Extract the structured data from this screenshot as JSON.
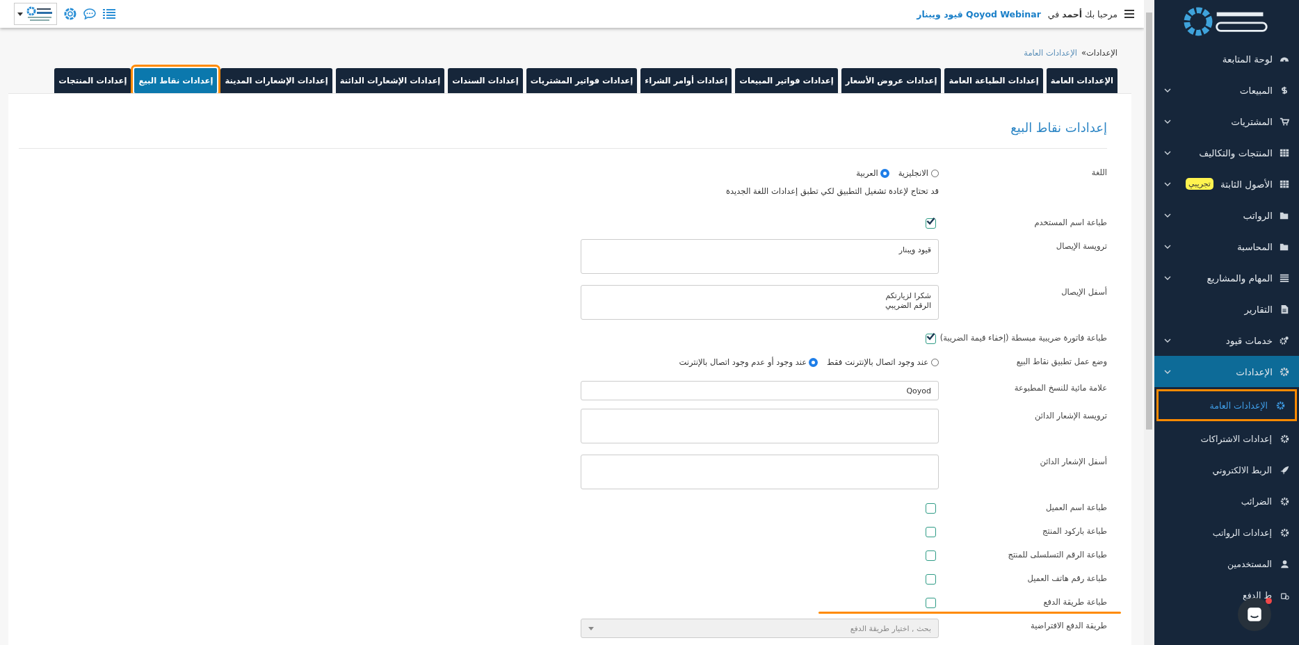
{
  "topbar": {
    "greeting": "مرحبا بك **أحمد** في",
    "company": "Qoyod Webinar قيود ويبنار"
  },
  "breadcrumb": {
    "parent": "الإعدادات»",
    "current": "الإعدادات العامة"
  },
  "tabs": [
    {
      "label": "الإعدادات العامة",
      "selected": false,
      "highlighted": false
    },
    {
      "label": "إعدادات الطباعة العامة",
      "selected": false,
      "highlighted": false
    },
    {
      "label": "إعدادات عروض الأسعار",
      "selected": false,
      "highlighted": false
    },
    {
      "label": "إعدادات فواتير المبيعات",
      "selected": false,
      "highlighted": false
    },
    {
      "label": "إعدادات أوامر الشراء",
      "selected": false,
      "highlighted": false
    },
    {
      "label": "إعدادات فواتير المشتريات",
      "selected": false,
      "highlighted": false
    },
    {
      "label": "إعدادات السندات",
      "selected": false,
      "highlighted": false
    },
    {
      "label": "إعدادات الإشعارات الدائنة",
      "selected": false,
      "highlighted": false
    },
    {
      "label": "إعدادات الإشعارات المدينة",
      "selected": false,
      "highlighted": false
    },
    {
      "label": "إعدادات نقاط البيع",
      "selected": true,
      "highlighted": true
    },
    {
      "label": "إعدادات المنتجات",
      "selected": false,
      "highlighted": false
    }
  ],
  "panel": {
    "title": "إعدادات نقاط البيع",
    "fields": [
      {
        "kind": "radio",
        "label": "اللغة",
        "options": [
          {
            "label": "الانجليزية",
            "selected": false
          },
          {
            "label": "العربية",
            "selected": true
          }
        ],
        "note": "قد تحتاج لإعادة تشغيل التطبيق لكي تطبق إعدادات اللغة الجديدة"
      },
      {
        "kind": "checkbox",
        "label": "طباعة اسم المستخدم",
        "checked": true,
        "underlined": false
      },
      {
        "kind": "textarea",
        "label": "ترويسة الإيصال",
        "value": "قيود ويبنار"
      },
      {
        "kind": "textarea",
        "label": "أسفل الإيصال",
        "value": "شكرا لزيارتكم\nالرقم الضريبي"
      },
      {
        "kind": "checkbox",
        "label": "طباعة فاتورة ضريبية مبسطة (إخفاء قيمة الضريبة)",
        "checked": true,
        "underlined": false
      },
      {
        "kind": "radio",
        "label": "وضع عمل تطبيق نقاط البيع",
        "options": [
          {
            "label": "عند وجود اتصال بالإنترنت فقط",
            "selected": false
          },
          {
            "label": "عند وجود أو عدم وجود اتصال بالإنترنت",
            "selected": true
          }
        ]
      },
      {
        "kind": "input",
        "label": "علامة مائية للنسخ المطبوعة",
        "value": "Qoyod"
      },
      {
        "kind": "textarea",
        "label": "ترويسة الإشعار الدائن"
      },
      {
        "kind": "textarea",
        "label": "أسفل الإشعار الدائن"
      },
      {
        "kind": "checkbox",
        "label": "طباعة اسم العميل",
        "checked": false,
        "underlined": false
      },
      {
        "kind": "checkbox",
        "label": "طباعة باركود المنتج",
        "checked": false,
        "underlined": false
      },
      {
        "kind": "checkbox",
        "label": "طباعة الرقم التسلسلى للمنتج",
        "checked": false,
        "underlined": false
      },
      {
        "kind": "checkbox",
        "label": "طباعة رقم هاتف العميل",
        "checked": false,
        "underlined": false
      },
      {
        "kind": "checkbox",
        "label": "طباعة طريقة الدفع",
        "checked": false,
        "underlined": true
      },
      {
        "kind": "select",
        "label": "طريقة الدفع الافتراضية",
        "placeholder": "بحث , اختيار طريقة الدفع"
      }
    ]
  },
  "sidebar": {
    "items": [
      {
        "label": "لوحة المتابعة",
        "collapsible": false,
        "expanded": false
      },
      {
        "label": "المبيعات",
        "collapsible": true,
        "expanded": false
      },
      {
        "label": "المشتريات",
        "collapsible": true,
        "expanded": false
      },
      {
        "label": "المنتجات والتكاليف",
        "collapsible": true,
        "expanded": false
      },
      {
        "label": "الأصول الثابتة",
        "badge": "تجريبي",
        "collapsible": true,
        "expanded": false
      },
      {
        "label": "الرواتب",
        "collapsible": true,
        "expanded": false
      },
      {
        "label": "المحاسبة",
        "collapsible": true,
        "expanded": false
      },
      {
        "label": "المهام والمشاريع",
        "collapsible": true,
        "expanded": false
      },
      {
        "label": "التقارير",
        "collapsible": false,
        "expanded": false
      },
      {
        "label": "خدمات قيود",
        "collapsible": true,
        "expanded": false
      },
      {
        "label": "الإعدادات",
        "collapsible": true,
        "expanded": true,
        "children": [
          {
            "label": "الإعدادات العامة",
            "selected": true,
            "highlighted": true
          },
          {
            "label": "إعدادات الاشتراكات",
            "selected": false,
            "highlighted": false
          },
          {
            "label": "الربط الالكتروني",
            "selected": false,
            "highlighted": false
          },
          {
            "label": "الضرائب",
            "selected": false,
            "highlighted": false
          },
          {
            "label": "إعدادات الرواتب",
            "selected": false,
            "highlighted": false
          },
          {
            "label": "المستخدمين",
            "selected": false,
            "highlighted": false
          },
          {
            "label": "ط الدفع",
            "selected": false,
            "highlighted": false
          }
        ]
      }
    ]
  }
}
